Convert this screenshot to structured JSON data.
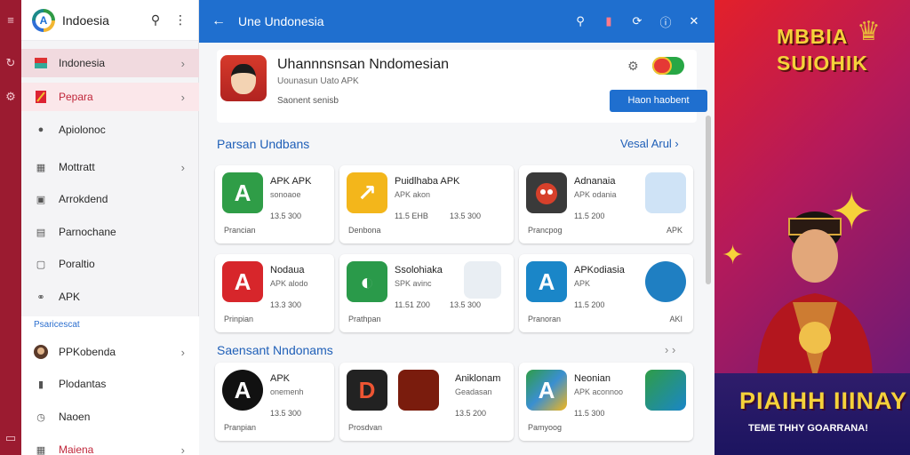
{
  "sidebar": {
    "title": "Indoesia",
    "items": [
      {
        "label": "Indonesia",
        "icon": "flag-icon",
        "chevron": true
      },
      {
        "label": "Pepara",
        "icon": "bookmark-icon",
        "chevron": true
      },
      {
        "label": "Apiolonoc",
        "icon": "clock-icon",
        "chevron": false
      },
      {
        "label": "Mottratt",
        "icon": "grid-icon",
        "chevron": true
      },
      {
        "label": "Arrokdend",
        "icon": "square-icon",
        "chevron": false
      },
      {
        "label": "Parnochane",
        "icon": "edit-icon",
        "chevron": false
      },
      {
        "label": "Poraltio",
        "icon": "document-icon",
        "chevron": false
      },
      {
        "label": "APK",
        "icon": "link-icon",
        "chevron": false
      }
    ],
    "section_label": "Psaricescat",
    "section_items": [
      {
        "label": "PPKobenda",
        "icon": "avatar",
        "chevron": true
      },
      {
        "label": "Plodantas",
        "icon": "bookmark-icon",
        "chevron": false
      },
      {
        "label": "Naoen",
        "icon": "clock-icon",
        "chevron": false
      },
      {
        "label": "Maiena",
        "icon": "grid-icon",
        "chevron": true
      }
    ]
  },
  "topbar": {
    "title": "Une Undonesia",
    "icons": [
      "search-icon",
      "bookmark-icon",
      "refresh-icon",
      "info-icon",
      "close-icon"
    ]
  },
  "app": {
    "name": "Uhannnsnsan Nndomesian",
    "sub": "Uounasun Uato APK",
    "sub2": "Saonent senisb",
    "install_label": "Haon haobent"
  },
  "section1": {
    "title": "Parsan Undbans",
    "link": "Vesal Arul ›"
  },
  "section2": {
    "title": "Saensant Nndonams"
  },
  "tiles_row1": [
    {
      "name": "APK APK",
      "sub": "sonoaoe",
      "size": "13.5 300",
      "foot": "Prancian",
      "color": "#2f9d47"
    },
    {
      "name": "Puidlhaba  APK",
      "sub": "APK akon",
      "size": "11.5 EHB",
      "size2": "13.5 300",
      "foot": "Denbona",
      "color": "#f3b61b"
    },
    {
      "name": "Adnanaia",
      "sub": "APK odania",
      "size": "11.5 200",
      "foot": "Prancpog",
      "right": "APK",
      "color": "#3a3a3a"
    }
  ],
  "tiles_row2": [
    {
      "name": "Nodaua",
      "sub": "APK alodo",
      "size": "13.3 300",
      "foot": "Prinpian",
      "color": "#d7262b"
    },
    {
      "name": "Ssolohiaka",
      "sub": "SPK avinc",
      "size": "11.51 Z00",
      "size2": "13.5 300",
      "foot": "Prathpan",
      "color": "#2a9a4a"
    },
    {
      "name": "APKodiasia",
      "sub": "APK",
      "size": "11.5 200",
      "foot": "Pranoran",
      "right": "AKI",
      "color": "#1a86c8"
    }
  ],
  "tiles_row3": [
    {
      "name": "APK",
      "sub": "onemenh",
      "size": "13.5 300",
      "foot": "Pranpian",
      "color": "#111111"
    },
    {
      "name": "Aniklonam",
      "sub": "Geadasan",
      "size": "13.5 200",
      "foot": "Prosdvan",
      "color": "#222222"
    },
    {
      "name": "Neonian",
      "sub": "APK aconnoo",
      "size": "11.5 300",
      "foot": "Pamyoog",
      "color": "#3a8fd1"
    }
  ],
  "banner": {
    "top_line1": "MBBIA",
    "top_line2": "SUIOHIK",
    "bottom": "PIAIHH IIINAY",
    "bottom_sub": "TEME THHY GOARRANA!"
  }
}
